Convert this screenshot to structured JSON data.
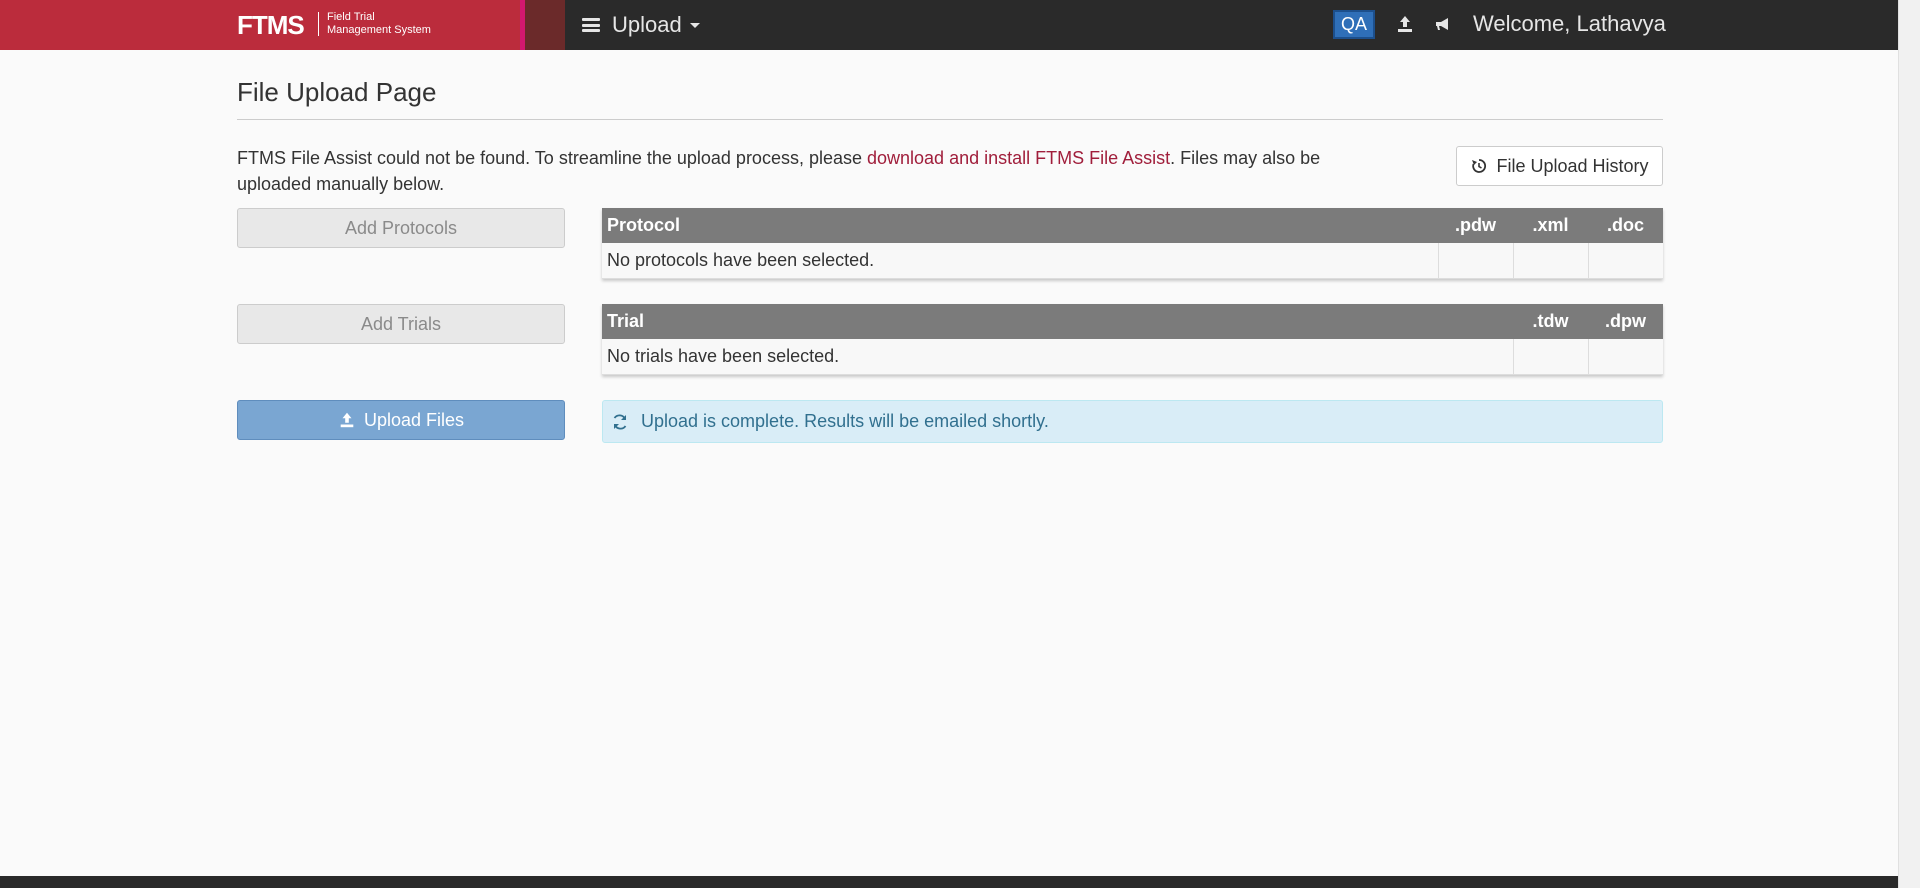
{
  "navbar": {
    "brand_logo": "FTMS",
    "brand_subtitle_line1": "Field Trial",
    "brand_subtitle_line2": "Management System",
    "menu_label": "Upload",
    "env_badge": "QA",
    "welcome": "Welcome, Lathavya",
    "icons": [
      "menu-icon",
      "upload-icon",
      "announcement-icon"
    ],
    "colors": {
      "brand": "#bb2c3c",
      "accent_stripe": "#d2186e",
      "bar": "#2a2a2a",
      "qa_badge": "#2f6fb8"
    }
  },
  "page": {
    "title": "File Upload Page",
    "notice_prefix": "FTMS File Assist could not be found. To streamline the upload process, please ",
    "notice_link": "download and install FTMS File Assist",
    "notice_suffix": ". Files may also be uploaded manually below.",
    "history_button": "File Upload History"
  },
  "actions": {
    "add_protocols": "Add Protocols",
    "add_trials": "Add Trials",
    "upload_files": "Upload Files"
  },
  "protocols_table": {
    "headers": [
      "Protocol",
      ".pdw",
      ".xml",
      ".doc"
    ],
    "empty_message": "No protocols have been selected."
  },
  "trials_table": {
    "headers": [
      "Trial",
      ".tdw",
      ".dpw"
    ],
    "empty_message": "No trials have been selected."
  },
  "status": {
    "message": "Upload is complete. Results will be emailed shortly.",
    "icon": "refresh-icon",
    "color": "#31708f"
  }
}
